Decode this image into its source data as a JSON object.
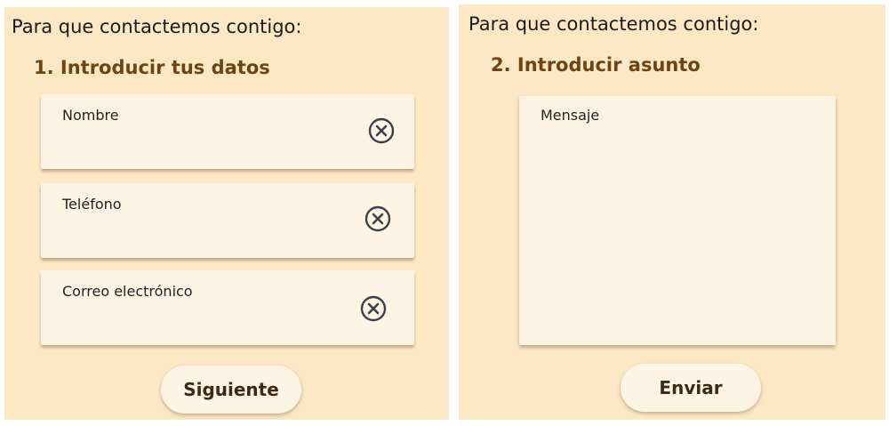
{
  "left_panel": {
    "intro": "Para que contactemos contigo:",
    "step_title": "1. Introducir tus datos",
    "fields": [
      {
        "label": "Nombre"
      },
      {
        "label": "Teléfono"
      },
      {
        "label": "Correo electrónico"
      }
    ],
    "clear_icon": "circle-x-icon",
    "next_label": "Siguiente"
  },
  "right_panel": {
    "intro": "Para que contactemos contigo:",
    "step_title": "2. Introducir asunto",
    "message_label": "Mensaje",
    "send_label": "Enviar"
  },
  "colors": {
    "panel_bg": "#fde8c5",
    "field_bg": "#fef4e3",
    "title_brown": "#6e4412",
    "icon_gray": "#3c3f4a"
  }
}
